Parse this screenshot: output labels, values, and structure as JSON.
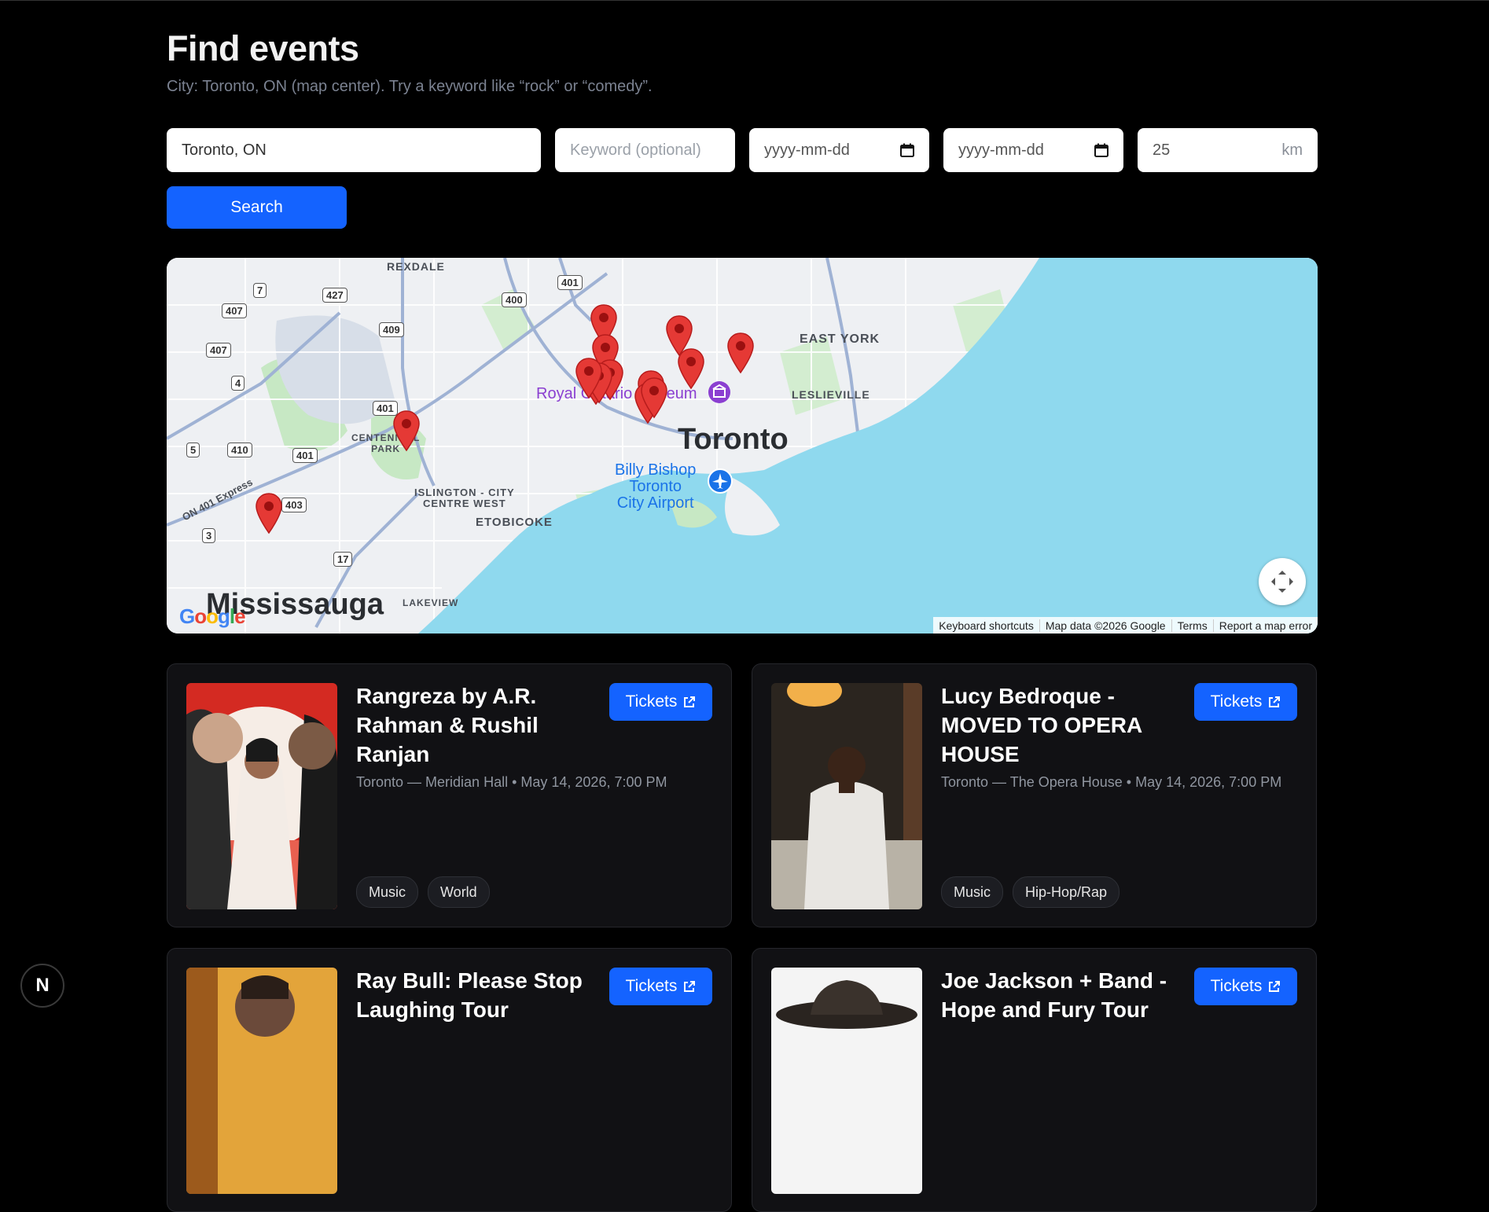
{
  "page": {
    "title": "Find events",
    "subtitle": "City: Toronto, ON (map center). Try a keyword like “rock” or “comedy”."
  },
  "search": {
    "city_value": "Toronto, ON",
    "keyword_placeholder": "Keyword (optional)",
    "start_date_placeholder": "yyyy-mm-dd",
    "end_date_placeholder": "yyyy-mm-dd",
    "radius_value": "25",
    "radius_unit": "km",
    "button_label": "Search"
  },
  "map": {
    "labels": {
      "rexdale": "REXDALE",
      "east_york": "EAST YORK",
      "leslieville": "LESLIEVILLE",
      "centennial_park": "CENTENNIAL\nPARK",
      "islington": "ISLINGTON - CITY\nCENTRE WEST",
      "etobicoke": "ETOBICOKE",
      "lakeview": "LAKEVIEW",
      "express": "ON 401 Express",
      "toronto": "Toronto",
      "mississauga": "Mississauga",
      "rom": "Royal Ontario Museum",
      "airport": "Billy Bishop\nToronto\nCity Airport"
    },
    "shields": [
      "7",
      "427",
      "401",
      "400",
      "407",
      "409",
      "407",
      "4",
      "401",
      "5",
      "410",
      "401",
      "403",
      "3",
      "17"
    ],
    "attribution": {
      "shortcuts": "Keyboard shortcuts",
      "data": "Map data ©2026 Google",
      "terms": "Terms",
      "report": "Report a map error"
    },
    "logo": "Google"
  },
  "events": [
    {
      "title": "Rangreza by A.R. Rahman & Rushil Ranjan",
      "meta": "Toronto — Meridian Hall • May 14, 2026, 7:00 PM",
      "tickets_label": "Tickets",
      "tags": [
        "Music",
        "World"
      ]
    },
    {
      "title": "Lucy Bedroque - MOVED TO OPERA HOUSE",
      "meta": "Toronto — The Opera House • May 14, 2026, 7:00 PM",
      "tickets_label": "Tickets",
      "tags": [
        "Music",
        "Hip-Hop/Rap"
      ]
    },
    {
      "title": "Ray Bull: Please Stop Laughing Tour",
      "meta": "",
      "tickets_label": "Tickets",
      "tags": []
    },
    {
      "title": "Joe Jackson + Band - Hope and Fury Tour",
      "meta": "",
      "tickets_label": "Tickets",
      "tags": []
    }
  ],
  "next_badge": "N",
  "colors": {
    "accent": "#1463ff",
    "background": "#000000",
    "card": "#111114",
    "water": "#8fd9ee",
    "pin": "#e53935"
  }
}
